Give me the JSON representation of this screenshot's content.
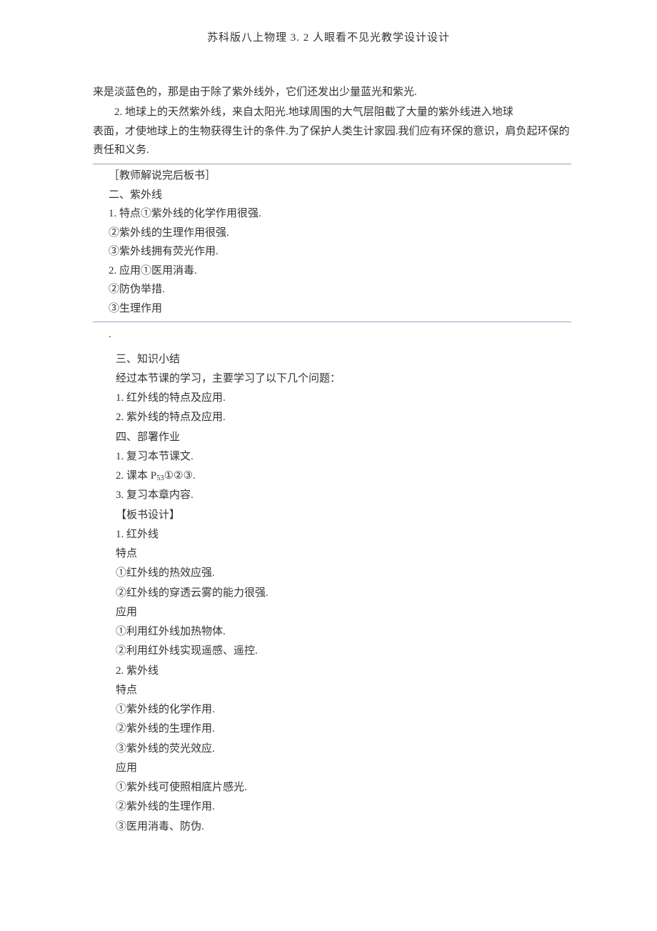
{
  "header": "苏科版八上物理 3. 2 人眼看不见光教学设计设计",
  "intro": {
    "line1": "来是淡蓝色的，那是由于除了紫外线外，它们还发出少量蓝光和紫光.",
    "line2": "2. 地球上的天然紫外线，来自太阳光.地球周围的大气层阻截了大量的紫外线进入地球",
    "line3": "表面，才使地球上的生物获得生计的条件.为了保护人类生计家园.我们应有环保的意识，肩负起环保的责任和义务."
  },
  "boxed": {
    "l0": "［教师解说完后板书］",
    "l1": "二、紫外线",
    "l2": "1. 特点①紫外线的化学作用很强.",
    "l3": "②紫外线的生理作用很强.",
    "l4": "③紫外线拥有荧光作用.",
    "l5": "2. 应用①医用消毒.",
    "l6": "②防伪举措.",
    "l7": "③生理作用"
  },
  "dot": ".",
  "summary": {
    "s1": "三、知识小结",
    "s2": "经过本节课的学习，主要学习了以下几个问题：",
    "s3": "1. 红外线的特点及应用.",
    "s4": "2. 紫外线的特点及应用.",
    "s5": "四、部署作业",
    "s6": "1. 复习本节课文.",
    "s7_a": "2. 课本 P",
    "s7_sub": "53",
    "s7_b": "①②③.",
    "s8": "3. 复习本章内容.",
    "s9": "【板书设计】",
    "s10": "1. 红外线",
    "s11": "特点",
    "s12": "①红外线的热效应强.",
    "s13": "②红外线的穿透云雾的能力很强.",
    "s14": "应用",
    "s15": "①利用红外线加热物体.",
    "s16": "②利用红外线实现遥感、遥控.",
    "s17": "2. 紫外线",
    "s18": "特点",
    "s19": "①紫外线的化学作用.",
    "s20": "②紫外线的生理作用.",
    "s21": "③紫外线的荧光效应.",
    "s22": "应用",
    "s23": "①紫外线可使照相底片感光.",
    "s24": "②紫外线的生理作用.",
    "s25": "③医用消毒、防伪."
  }
}
